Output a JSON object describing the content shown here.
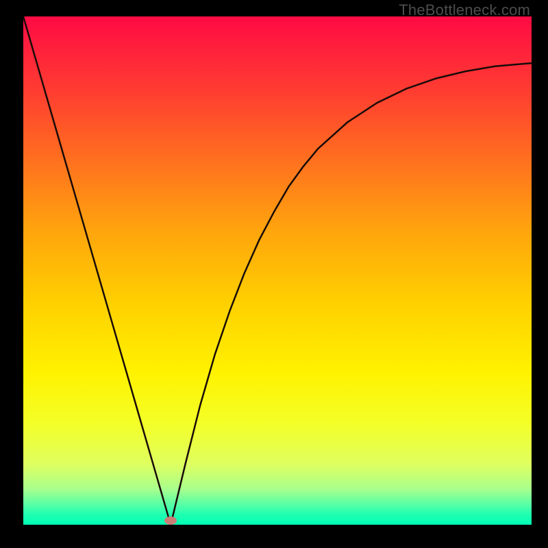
{
  "watermark": "TheBottleneck.com",
  "marker": {
    "x_frac": 0.29,
    "y_frac": 0.992
  },
  "chart_data": {
    "type": "line",
    "title": "",
    "xlabel": "",
    "ylabel": "",
    "xlim": [
      0,
      1
    ],
    "ylim": [
      0,
      1
    ],
    "series": [
      {
        "name": "curve",
        "x": [
          0.0,
          0.029,
          0.058,
          0.087,
          0.116,
          0.145,
          0.174,
          0.203,
          0.232,
          0.261,
          0.29,
          0.319,
          0.348,
          0.377,
          0.406,
          0.435,
          0.464,
          0.493,
          0.522,
          0.551,
          0.58,
          0.638,
          0.696,
          0.754,
          0.812,
          0.87,
          0.928,
          0.986,
          1.0
        ],
        "y": [
          1.0,
          0.9,
          0.8,
          0.7,
          0.6,
          0.5,
          0.4,
          0.3,
          0.2,
          0.1,
          0.0,
          0.12,
          0.235,
          0.335,
          0.42,
          0.495,
          0.56,
          0.615,
          0.665,
          0.705,
          0.74,
          0.792,
          0.83,
          0.858,
          0.878,
          0.892,
          0.902,
          0.907,
          0.908
        ]
      }
    ],
    "marker_point": {
      "x": 0.29,
      "y": 0.008
    }
  },
  "colors": {
    "curve_stroke": "#180b08",
    "marker_fill": "#c97d76",
    "background": "#000000"
  }
}
